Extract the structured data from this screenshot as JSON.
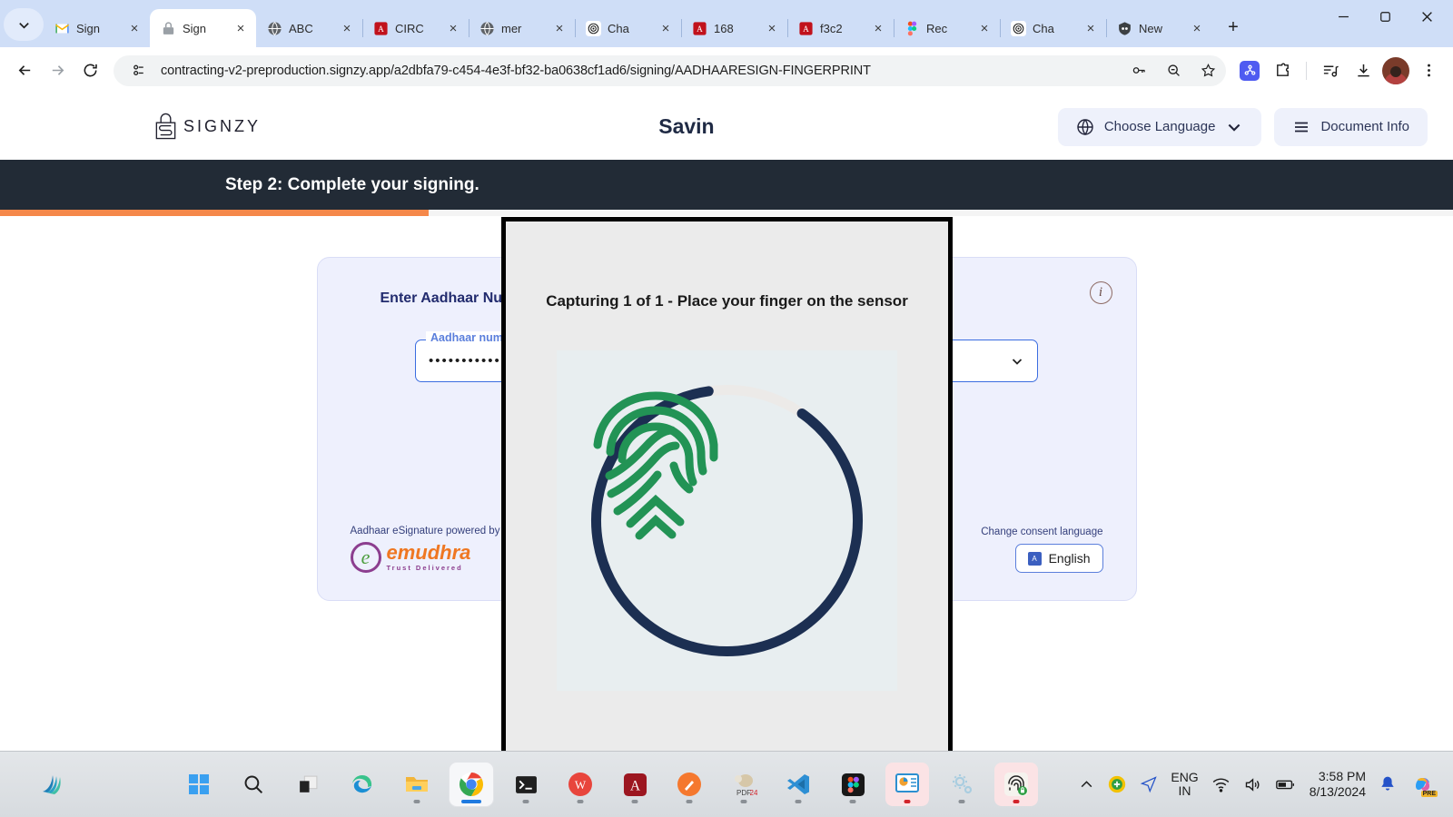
{
  "browser": {
    "tabs": [
      {
        "title": "Sign",
        "favicon": "gmail-icon",
        "active": false
      },
      {
        "title": "Sign",
        "favicon": "lock-icon",
        "active": true
      },
      {
        "title": "ABC",
        "favicon": "globe-icon",
        "active": false
      },
      {
        "title": "CIRC",
        "favicon": "pdf-icon",
        "active": false
      },
      {
        "title": "mer",
        "favicon": "globe-icon",
        "active": false
      },
      {
        "title": "Cha",
        "favicon": "openai-icon",
        "active": false
      },
      {
        "title": "168",
        "favicon": "pdf-icon",
        "active": false
      },
      {
        "title": "f3c2",
        "favicon": "pdf-icon",
        "active": false
      },
      {
        "title": "Rec",
        "favicon": "figma-icon",
        "active": false
      },
      {
        "title": "Cha",
        "favicon": "openai-icon",
        "active": false
      },
      {
        "title": "New",
        "favicon": "chrome-incognito-icon",
        "active": false
      }
    ],
    "new_tab_label": "+",
    "tab_close_label": "×",
    "url": "contracting-v2-preproduction.signzy.app/a2dbfa79-c454-4e3f-bf32-ba0638cf1ad6/signing/AADHAARESIGN-FINGERPRINT",
    "toolbar_icons": [
      "back-icon",
      "forward-icon",
      "reload-icon",
      "site-info-icon",
      "password-key-icon",
      "zoom-out-icon",
      "bookmark-star-icon",
      "extension-puzzle-icon",
      "media-control-icon",
      "downloads-icon",
      "profile-avatar",
      "chrome-menu-icon"
    ],
    "window_controls": [
      "minimize",
      "restore",
      "close"
    ]
  },
  "site": {
    "logo_text": "SIGNZY",
    "header_title": "Savin",
    "choose_language_label": "Choose Language",
    "document_info_label": "Document Info",
    "step_banner": "Step 2: Complete your signing.",
    "progress_percent": 29.5
  },
  "aadhaar_card": {
    "title": "Enter Aadhaar Number / Virt",
    "field_label": "Aadhaar numb",
    "field_value": "••••••••••••",
    "info_icon_label": "i",
    "secondary_button": "",
    "primary_button": "",
    "powered_by_label": "Aadhaar eSignature powered by",
    "emudhra_mark": "e",
    "emudhra_name": "emudhra",
    "emudhra_tagline": "Trust Delivered",
    "consent_label": "Change consent language",
    "consent_value": "English"
  },
  "capture_modal": {
    "title": "Capturing 1 of 1 - Place your finger on the sensor",
    "ring_progress_percent": 88,
    "colors": {
      "ring_active": "#1c2f52",
      "ring_track": "#eceae8",
      "fingerprint": "#229355",
      "stage_background": "#e8eef0",
      "modal_background": "#ebebeb"
    }
  },
  "taskbar": {
    "apps": [
      "weather-widget-icon",
      "start-icon",
      "search-icon",
      "task-view-icon",
      "edge-icon",
      "file-explorer-icon",
      "chrome-icon",
      "terminal-icon",
      "wps-office-icon",
      "acrobat-reader-icon",
      "snipping-tool-icon",
      "pdf24-icon",
      "vs-code-icon",
      "figma-icon",
      "presentation-icon",
      "settings-icon",
      "biometric-rd-service-icon"
    ],
    "tray": {
      "overflow_label": "^",
      "icons": [
        "shield-update-icon",
        "location-icon",
        "wifi-icon",
        "volume-icon",
        "battery-icon",
        "notification-bell-icon",
        "copilot-icon"
      ],
      "language_line1": "ENG",
      "language_line2": "IN",
      "time": "3:58 PM",
      "date": "8/13/2024",
      "copilot_badge": "PRE"
    }
  },
  "colors": {
    "tabstrip": "#cfdef7",
    "banner_dark": "#222b36",
    "progress_orange": "#f5884a",
    "card_background": "#eef0fd",
    "primary_red": "#d2194d",
    "secondary_red": "#90494c",
    "field_border_blue": "#3b6de0"
  }
}
